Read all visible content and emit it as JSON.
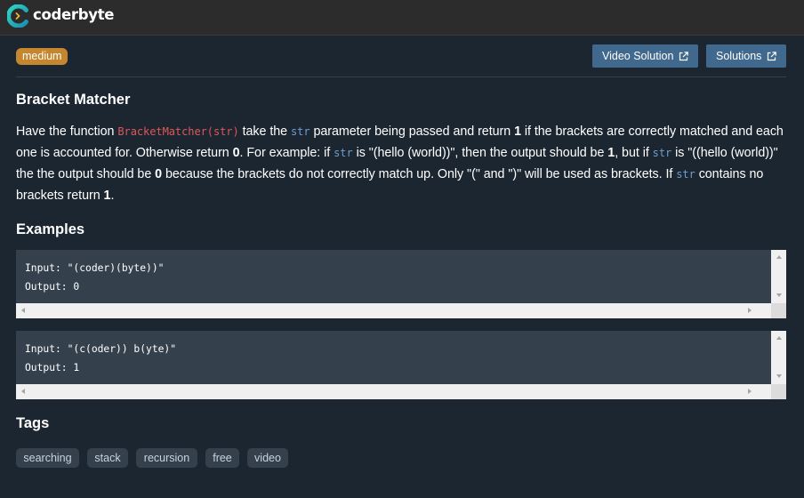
{
  "header": {
    "brand": "coderbyte",
    "logo_icon": "coderbyte-logo-icon"
  },
  "challenge": {
    "difficulty": "medium",
    "title": "Bracket Matcher",
    "buttons": {
      "video_solution": "Video Solution",
      "solutions": "Solutions",
      "external_icon": "external-link-icon"
    },
    "description": {
      "p1": "Have the function ",
      "fn": "BracketMatcher(str)",
      "p2": " take the ",
      "str": "str",
      "p3": " parameter being passed and return ",
      "one": "1",
      "p4": " if the brackets are correctly matched and each one is accounted for. Otherwise return ",
      "zero": "0",
      "p5": ". For example: if ",
      "p6": " is \"(hello (world))\", then the output should be ",
      "p7": ", but if ",
      "p8": " is \"((hello (world))\" the the output should be ",
      "p9": " because the brackets do not correctly match up. Only \"(\" and \")\" will be used as brackets. If ",
      "p10": " contains no brackets return ",
      "p11": "."
    }
  },
  "examples": {
    "heading": "Examples",
    "items": [
      {
        "input_label": "Input: ",
        "input": "\"(coder)(byte))\"",
        "output_label": "Output: ",
        "output": "0"
      },
      {
        "input_label": "Input: ",
        "input": "\"(c(oder)) b(yte)\"",
        "output_label": "Output: ",
        "output": "1"
      }
    ]
  },
  "tags": {
    "heading": "Tags",
    "items": [
      "searching",
      "stack",
      "recursion",
      "free",
      "video"
    ]
  },
  "colors": {
    "background": "#1c2630",
    "topbar": "#2c2c2c",
    "difficulty_badge": "#c4862e",
    "button": "#41698d",
    "code_function": "#e0565b",
    "code_variable": "#6f9ed3",
    "example_box": "#34414d"
  }
}
